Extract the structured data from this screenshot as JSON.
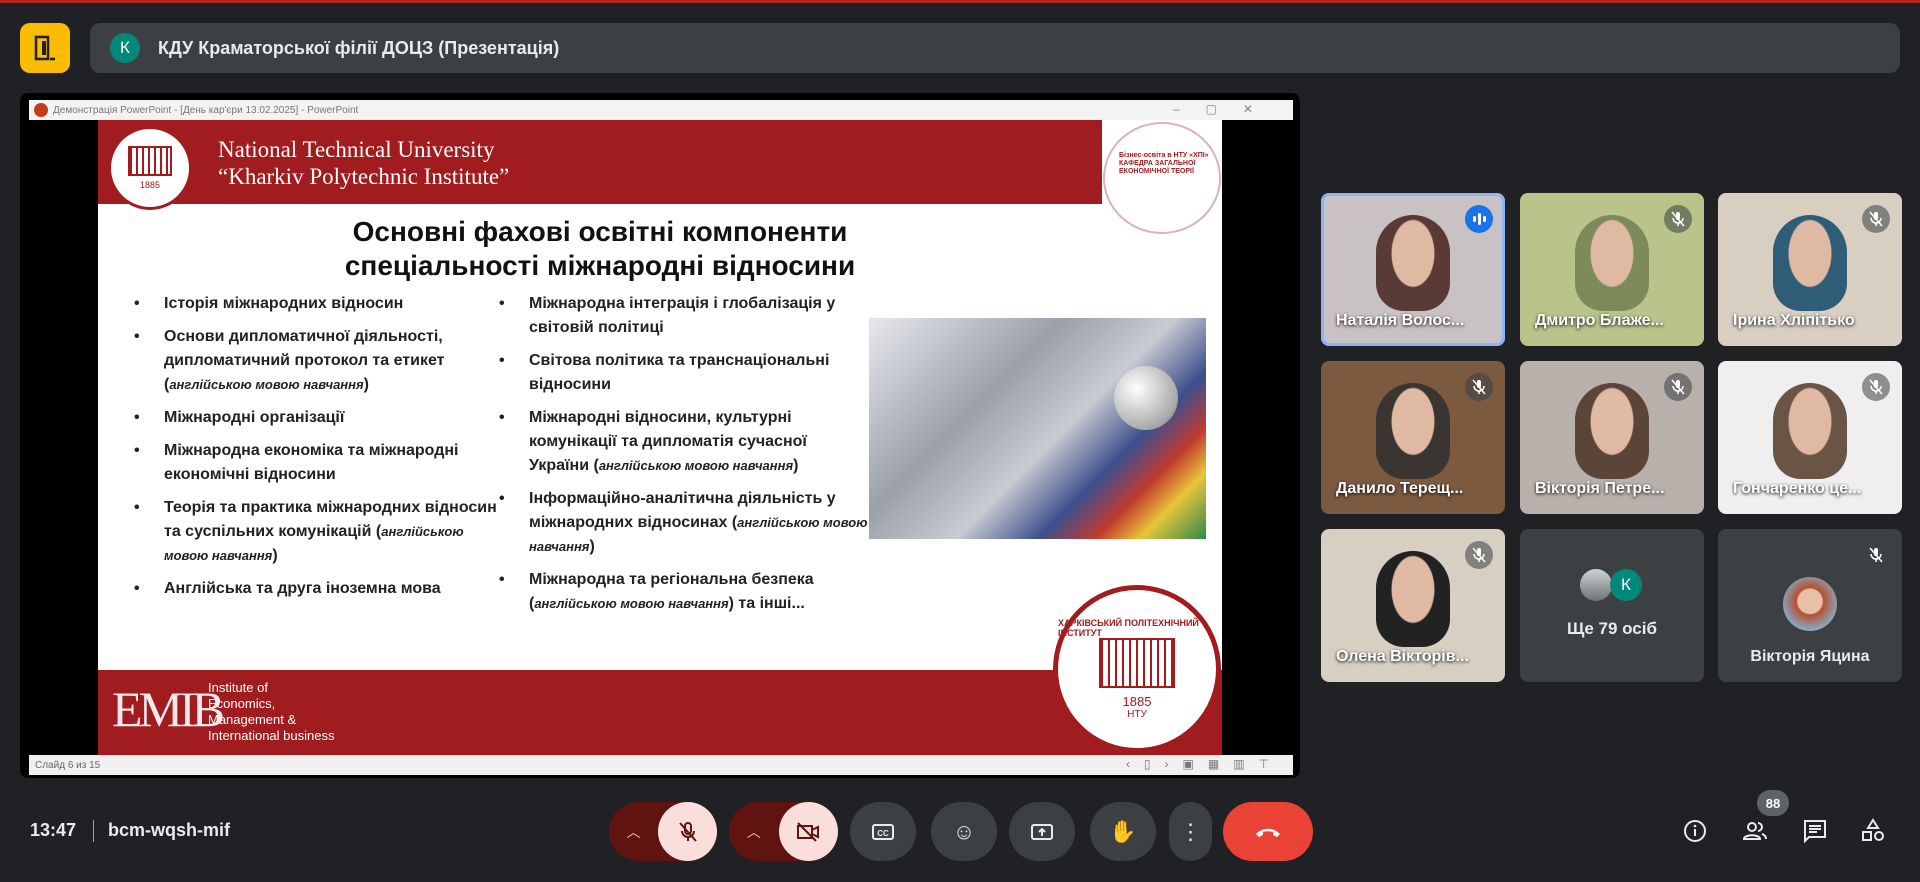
{
  "meet": {
    "title": "КДУ Краматорської філії ДОЦЗ (Презентація)",
    "avatar_letter": "К",
    "time": "13:47",
    "meeting_code": "bcm-wqsh-mif",
    "participants_count": "88"
  },
  "powerpoint": {
    "window_title": "Демонстрація PowerPoint - [День кар'єри 13.02.2025] - PowerPoint",
    "status": "Слайд 6 из 15"
  },
  "slide": {
    "university_line1": "National Technical University",
    "university_line2": "“Kharkiv Polytechnic Institute”",
    "crest_year": "1885",
    "dept_logo": "Бізнес-освіта в НТУ «ХПІ» КАФЕДРА ЗАГАЛЬНОЇ ЕКОНОМІЧНОЇ ТЕОРІЇ",
    "title_line1": "Основні фахові освітні компоненти",
    "title_line2": "спеціальності міжнародні відносини",
    "left_items": [
      {
        "text": "Історія міжнародних відносин",
        "note": ""
      },
      {
        "text": " Основи дипломатичної діяльності, дипломатичний протокол та етикет",
        "note": "англійською мовою навчання"
      },
      {
        "text": "Міжнародні організації",
        "note": ""
      },
      {
        "text": "Міжнародна економіка та міжнародні економічні відносини",
        "note": ""
      },
      {
        "text": "Теорія та практика міжнародних відносин та суспільних комунікацій",
        "note": "англійською мовою навчання"
      },
      {
        "text": "Англійська та друга іноземна мова",
        "note": ""
      }
    ],
    "right_items": [
      {
        "text": "Міжнародна інтеграція і глобалізація у світовій політиці",
        "note": "",
        "suffix": ""
      },
      {
        "text": "Світова політика та транснаціональні відносини",
        "note": "",
        "suffix": ""
      },
      {
        "text": "Міжнародні відносини, культурні комунікації та дипломатія сучасної України",
        "note": "англійською мовою навчання",
        "suffix": ""
      },
      {
        "text": "Інформаційно-аналітична діяльність у міжнародних відносинах",
        "note": "англійською мовою навчання",
        "suffix": ""
      },
      {
        "text": "Міжнародна та регіональна безпека",
        "note": "англійською мовою навчання",
        "suffix": " та інші..."
      }
    ],
    "institute_logo": "EMIB",
    "institute_line1": "Institute of",
    "institute_line2": "Economics,",
    "institute_line3": "Management &",
    "institute_line4": "International business",
    "seal_text": "ХАРКІВСЬКИЙ ПОЛІТЕХНІЧНИЙ ІНСТИТУТ",
    "seal_year": "1885",
    "seal_abbr": "НТУ"
  },
  "participants": [
    {
      "name": "Наталія Волос...",
      "speaking": true,
      "bg": "#c9c2c4",
      "face": "#5a3a34"
    },
    {
      "name": "Дмитро Блаже...",
      "muted": true,
      "bg": "#b9c48a",
      "face": "#7d8a5a"
    },
    {
      "name": "Ірина Хліпітько",
      "muted": true,
      "bg": "#d8cfc2",
      "face": "#2f5d78"
    },
    {
      "name": "Данило Терещ...",
      "muted": true,
      "bg": "#7b5a40",
      "face": "#3a3530"
    },
    {
      "name": "Вікторія Петре...",
      "muted": true,
      "bg": "#b8b0aa",
      "face": "#5a4538"
    },
    {
      "name": "Гончаренко це...",
      "muted": true,
      "bg": "#efefef",
      "face": "#6a5545"
    },
    {
      "name": "Олена Вікторів...",
      "muted": true,
      "bg": "#d6cfc2",
      "face": "#222"
    }
  ],
  "others": {
    "label": "Ще 79 осіб",
    "avatar_letter": "К"
  },
  "last_tile": {
    "name": "Вікторія Яцина",
    "muted": true
  },
  "controls": [
    "mic-off",
    "camera-off",
    "captions",
    "emoji",
    "present",
    "raise-hand",
    "more-options",
    "leave-call"
  ],
  "colors": {
    "accent": "#8ab4f8",
    "leave": "#ea4335",
    "slide_red": "#a01c1f"
  }
}
